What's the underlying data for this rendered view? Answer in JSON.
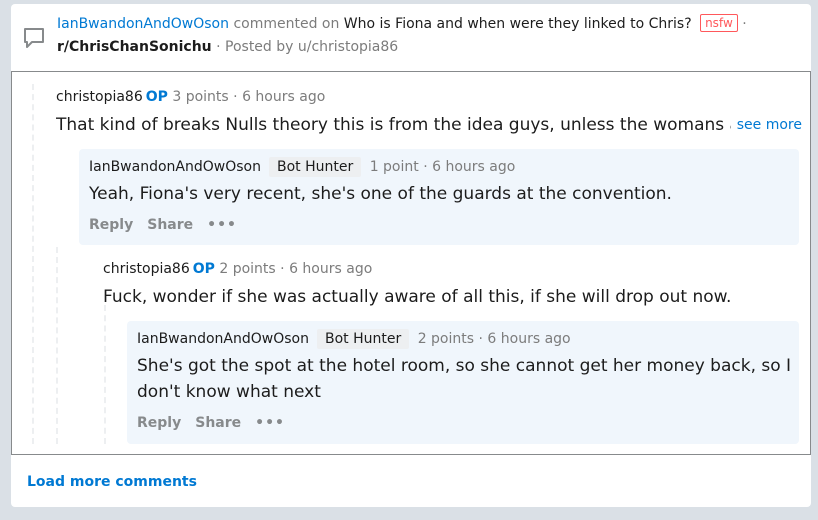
{
  "header": {
    "commenter": "IanBwandonAndOwOson",
    "commented_on": "commented on",
    "post_title": "Who is Fiona and when were they linked to Chris?",
    "nsfw_tag": "nsfw",
    "separator": "·",
    "subreddit": "r/ChrisChanSonichu",
    "posted_by": "· Posted by u/christopia86"
  },
  "comments": [
    {
      "author": "christopia86",
      "op_badge": "OP",
      "score": "3 points",
      "time": "· 6 hours ago",
      "text": "That kind of breaks Nulls theory this is from the idea guys, unless the womans aud",
      "see_more": "see more"
    },
    {
      "author": "IanBwandonAndOwOson",
      "flair": "Bot Hunter",
      "score": "1 point",
      "time": "· 6 hours ago",
      "text": "Yeah, Fiona's very recent, she's one of the guards at the convention.",
      "reply": "Reply",
      "share": "Share",
      "more": "•••"
    },
    {
      "author": "christopia86",
      "op_badge": "OP",
      "score": "2 points",
      "time": "· 6 hours ago",
      "text": "Fuck, wonder if she was actually aware of all this, if she will drop out now."
    },
    {
      "author": "IanBwandonAndOwOson",
      "flair": "Bot Hunter",
      "score": "2 points",
      "time": "· 6 hours ago",
      "text_line1": "She's got the spot at the hotel room, so she cannot get her money back, so I",
      "text_line2": "don't know what next",
      "reply": "Reply",
      "share": "Share",
      "more": "•••"
    }
  ],
  "footer": {
    "load_more": "Load more comments"
  },
  "icons": {
    "comment": "chat-bubble-icon",
    "more": "more-dots-icon"
  },
  "colors": {
    "link_blue": "#0079d3",
    "nsfw_red": "#ff585b",
    "highlight_bg": "#f0f6fc",
    "page_bg": "#dae0e6"
  }
}
